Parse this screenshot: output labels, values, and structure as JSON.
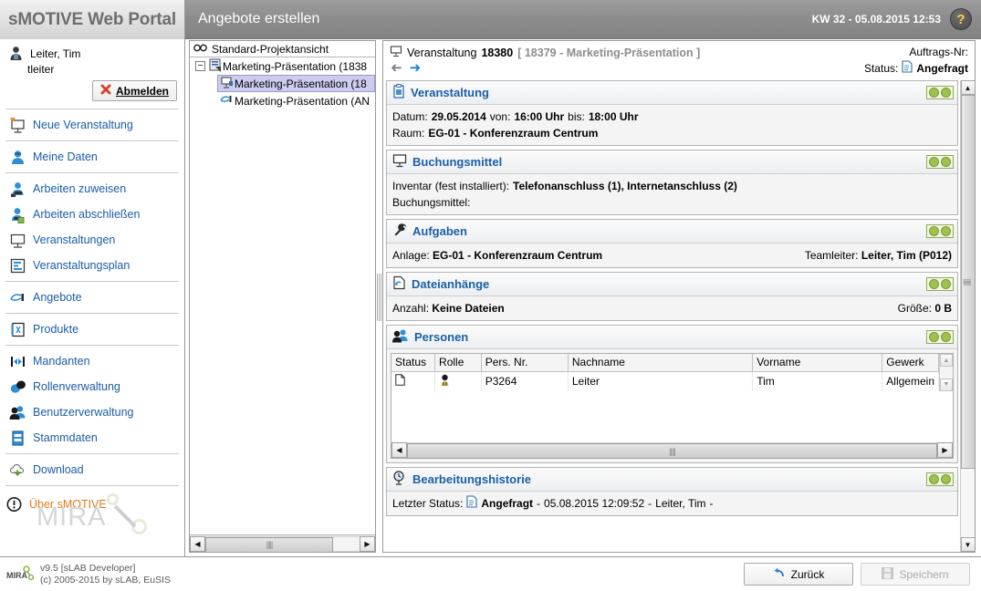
{
  "header": {
    "logo": "sMOTIVE Web Portal",
    "page_title": "Angebote erstellen",
    "kw_datetime": "KW 32 - 05.08.2015 12:53",
    "help_label": "?"
  },
  "sidebar": {
    "user": {
      "name": "Leiter, Tim",
      "login": "tleiter"
    },
    "logout_button": {
      "prefix": "A",
      "underline": "b",
      "rest": "melden",
      "full": "Abmelden"
    },
    "groups": [
      {
        "items": [
          {
            "label": "Neue Veranstaltung",
            "icon": "new-presentation-icon"
          }
        ]
      },
      {
        "items": [
          {
            "label": "Meine Daten",
            "icon": "user-blue-icon"
          }
        ]
      },
      {
        "items": [
          {
            "label": "Arbeiten zuweisen",
            "icon": "assign-work-icon"
          },
          {
            "label": "Arbeiten abschließen",
            "icon": "complete-work-icon"
          },
          {
            "label": "Veranstaltungen",
            "icon": "presentation-icon"
          },
          {
            "label": "Veranstaltungsplan",
            "icon": "schedule-icon"
          }
        ]
      },
      {
        "items": [
          {
            "label": "Angebote",
            "icon": "offer-icon"
          }
        ]
      },
      {
        "items": [
          {
            "label": "Produkte",
            "icon": "products-book-icon"
          }
        ]
      },
      {
        "items": [
          {
            "label": "Mandanten",
            "icon": "clients-arrows-icon"
          },
          {
            "label": "Rollenverwaltung",
            "icon": "roles-masks-icon"
          },
          {
            "label": "Benutzerverwaltung",
            "icon": "users-icon"
          },
          {
            "label": "Stammdaten",
            "icon": "master-data-icon"
          }
        ]
      },
      {
        "items": [
          {
            "label": "Download",
            "icon": "download-cloud-icon"
          }
        ]
      }
    ],
    "mira_watermark": "MIRA",
    "about_label": "Über sMOTIVE"
  },
  "tree": {
    "header": "Standard-Projektansicht",
    "nodes": [
      {
        "label": "Marketing-Präsentation (1838",
        "level": 0,
        "expanded": true,
        "selected": false,
        "icon": "project-icon"
      },
      {
        "label": "Marketing-Präsentation (18",
        "level": 1,
        "expanded": false,
        "selected": true,
        "icon": "event-icon"
      },
      {
        "label": "Marketing-Präsentation (AN",
        "level": 1,
        "expanded": false,
        "selected": false,
        "icon": "offer-icon"
      }
    ]
  },
  "main": {
    "event_label": "Veranstaltung",
    "event_number": "18380",
    "event_ref": "[ 18379 - Marketing-Präsentation ]",
    "auftrags_nr_label": "Auftrags-Nr:",
    "auftrags_nr_value": "",
    "status_label": "Status:",
    "status_value": "Angefragt",
    "sections": [
      {
        "id": "veranstaltung",
        "title": "Veranstaltung",
        "icon": "clipboard-icon",
        "rows": [
          {
            "type": "inline",
            "parts": [
              {
                "label": "Datum:",
                "value": "29.05.2014"
              },
              {
                "label": "von:",
                "value": "16:00 Uhr"
              },
              {
                "label": "bis:",
                "value": "18:00 Uhr"
              }
            ]
          },
          {
            "type": "inline",
            "parts": [
              {
                "label": "Raum:",
                "value": "EG-01 - Konferenzraum Centrum"
              }
            ]
          }
        ]
      },
      {
        "id": "buchungsmittel",
        "title": "Buchungsmittel",
        "icon": "presentation-icon",
        "rows": [
          {
            "type": "inline",
            "parts": [
              {
                "label": "Inventar (fest installiert):",
                "value": "Telefonanschluss (1), Internetanschluss (2)"
              }
            ]
          },
          {
            "type": "inline",
            "parts": [
              {
                "label": "Buchungsmittel:",
                "value": ""
              }
            ]
          }
        ]
      },
      {
        "id": "aufgaben",
        "title": "Aufgaben",
        "icon": "wrench-icon",
        "rows": [
          {
            "type": "split",
            "left": {
              "label": "Anlage:",
              "value": "EG-01 - Konferenzraum Centrum"
            },
            "right": {
              "label": "Teamleiter:",
              "value": "Leiter, Tim (P012)"
            }
          }
        ]
      },
      {
        "id": "dateianhaenge",
        "title": "Dateianhänge",
        "icon": "attachment-icon",
        "rows": [
          {
            "type": "split",
            "left": {
              "label": "Anzahl:",
              "value": "Keine Dateien"
            },
            "right": {
              "label": "Größe:",
              "value": "0 B"
            }
          }
        ]
      },
      {
        "id": "personen",
        "title": "Personen",
        "icon": "people-icon",
        "table": {
          "columns": [
            "Status",
            "Rolle",
            "Pers. Nr.",
            "Nachname",
            "Vorname",
            "Gewerk"
          ],
          "rows": [
            {
              "status": "document-icon",
              "rolle": "person-icon",
              "pers_nr": "P3264",
              "nachname": "Leiter",
              "vorname": "Tim",
              "gewerk": "Allgemein"
            }
          ]
        }
      },
      {
        "id": "bearbeitungshistorie",
        "title": "Bearbeitungshistorie",
        "icon": "history-clock-icon",
        "rows": [
          {
            "type": "history",
            "label": "Letzter Status:",
            "status": "Angefragt",
            "timestamp": "05.08.2015 12:09:52",
            "user": "Leiter, Tim",
            "trail": "-"
          }
        ]
      }
    ],
    "toggle_state": "on"
  },
  "footer": {
    "version": "v9.5 [sLAB Developer]",
    "copyright": "(c) 2005-2015 by sLAB, EuSIS",
    "logo": "MIRA",
    "back_button": "Zurück",
    "save_button": "Speichern"
  }
}
